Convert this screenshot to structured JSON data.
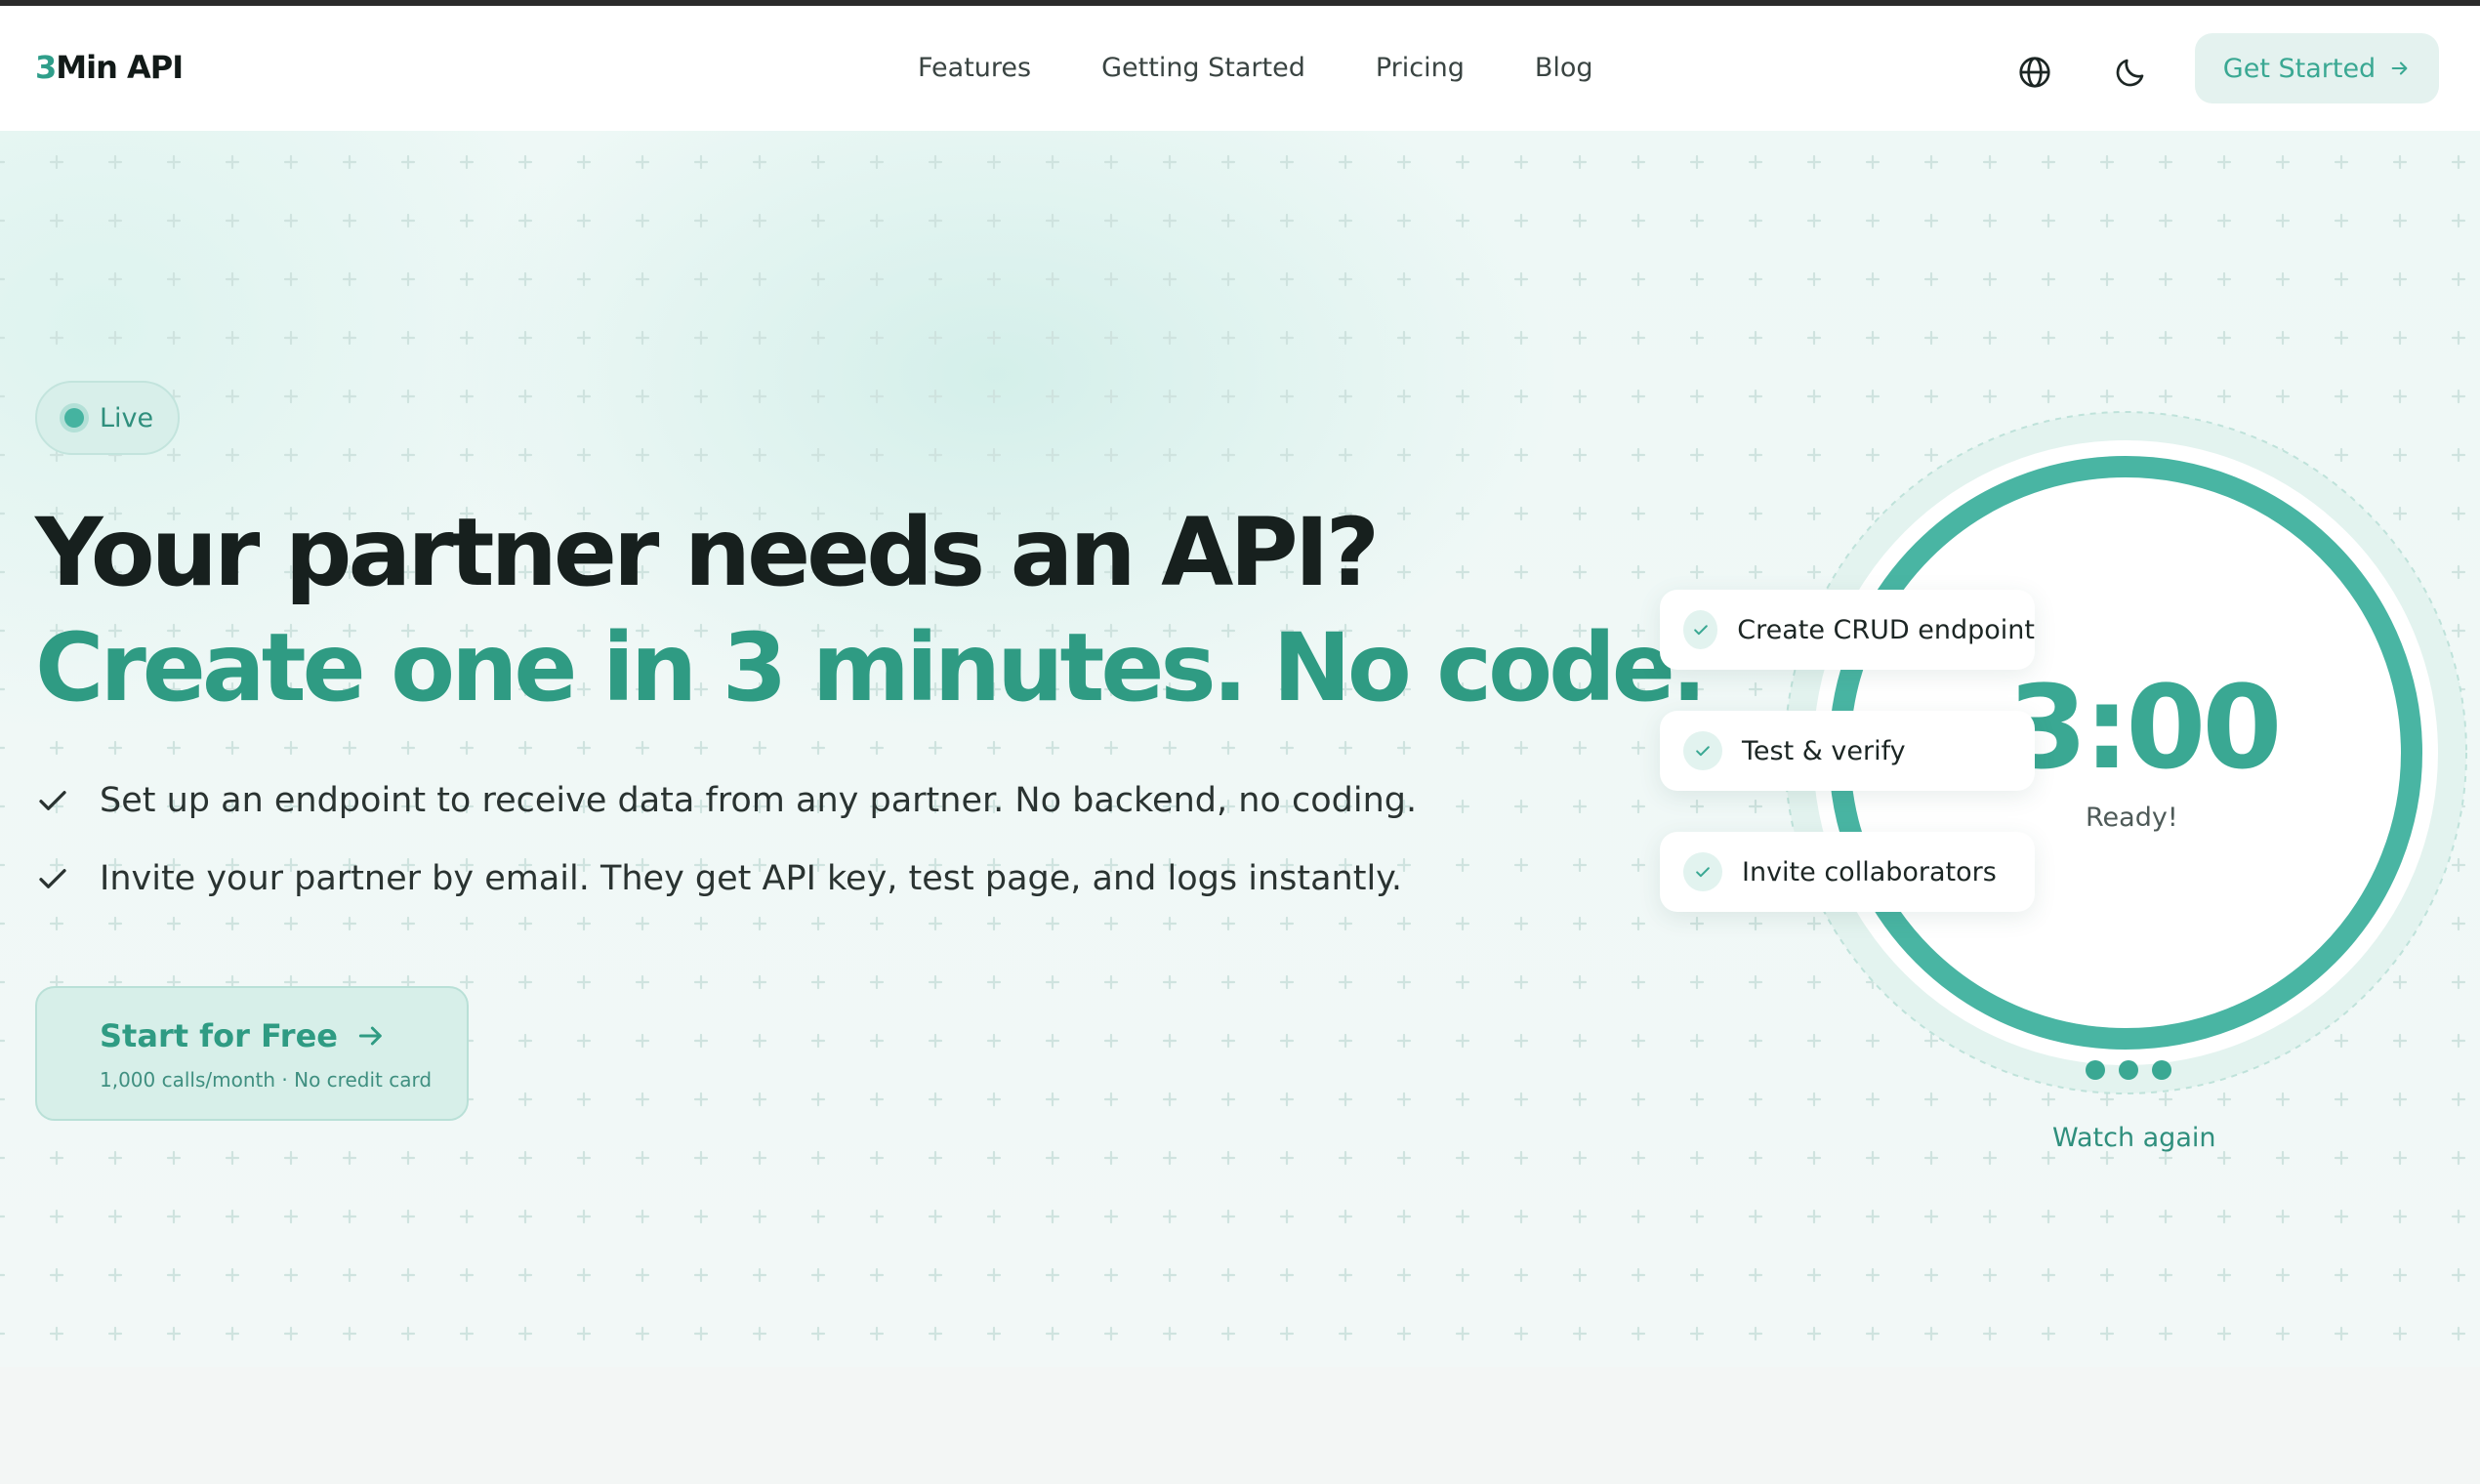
{
  "brand": {
    "logo_num": "3",
    "logo_text": "Min API"
  },
  "nav": {
    "links": [
      "Features",
      "Getting Started",
      "Pricing",
      "Blog"
    ],
    "cta_label": "Get Started"
  },
  "hero": {
    "badge": "Live",
    "headline": "Your partner needs an API?",
    "subheadline": "Create one in 3 minutes. No code.",
    "bullets": [
      "Set up an endpoint to receive data from any partner. No backend, no coding.",
      "Invite your partner by email. They get API key, test page, and logs instantly."
    ],
    "cta_label": "Start for Free",
    "cta_sub": "1,000 calls/month · No credit card"
  },
  "timer": {
    "value": "3:00",
    "status": "Ready!",
    "progress": 1.0,
    "steps": [
      "Create CRUD endpoint",
      "Test & verify",
      "Invite collaborators"
    ],
    "watch_again": "Watch again"
  },
  "colors": {
    "accent": "#3aa893",
    "accent_dark": "#2f9b83",
    "heading": "#17201e",
    "badge_bg": "#d8efea"
  }
}
